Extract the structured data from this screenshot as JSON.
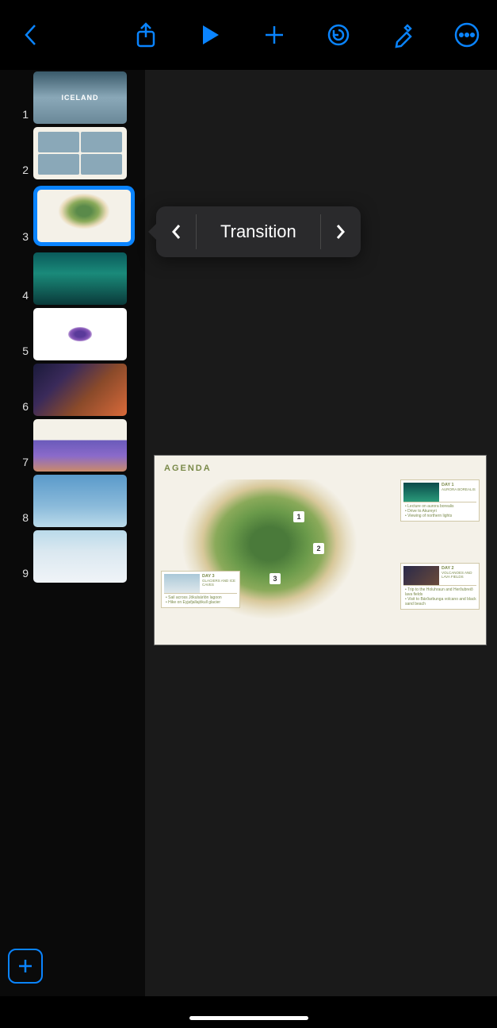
{
  "toolbar": {
    "back": "Back",
    "share": "Share",
    "play": "Play",
    "add": "Add",
    "undo": "Undo",
    "format": "Format",
    "more": "More"
  },
  "popover": {
    "prev": "Previous",
    "label": "Transition",
    "next": "Next"
  },
  "slides": [
    {
      "num": "1",
      "title": "ICELAND"
    },
    {
      "num": "2",
      "title": ""
    },
    {
      "num": "3",
      "title": ""
    },
    {
      "num": "4",
      "title": ""
    },
    {
      "num": "5",
      "title": ""
    },
    {
      "num": "6",
      "title": ""
    },
    {
      "num": "7",
      "title": ""
    },
    {
      "num": "8",
      "title": ""
    },
    {
      "num": "9",
      "title": ""
    }
  ],
  "selected_index": 2,
  "main": {
    "title": "AGENDA",
    "pins": [
      "1",
      "2",
      "3"
    ],
    "day1": {
      "title": "DAY 1",
      "sub": "AURORA BOREALIS",
      "items": [
        "Lecture on aurora borealis",
        "Drive to Akureyri",
        "Viewing of northern lights"
      ]
    },
    "day2": {
      "title": "DAY 2",
      "sub": "VOLCANOES AND LAVA FIELDS",
      "items": [
        "Trip to the Holuhraun and Herðubreið lava fields",
        "Visit to Bárðarbunga volcano and black sand beach"
      ]
    },
    "day3": {
      "title": "DAY 3",
      "sub": "GLACIERS AND ICE CAVES",
      "items": [
        "Sail across Jökulsárlón lagoon",
        "Hike on Eyjafjallajökull glacier"
      ]
    }
  },
  "add_slide": "Add Slide"
}
